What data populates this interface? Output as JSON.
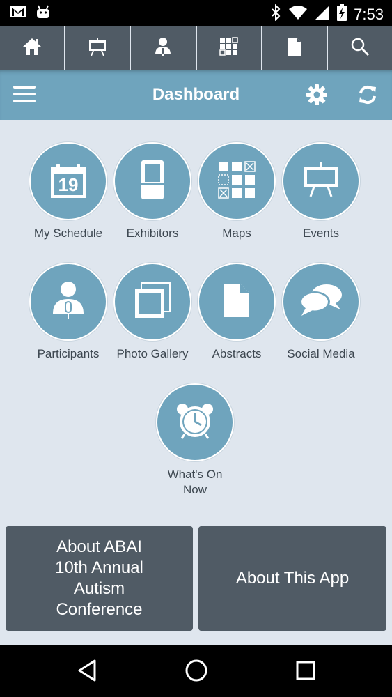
{
  "status_bar": {
    "time": "7:53",
    "left_icons": [
      "gmail-icon",
      "android-icon"
    ],
    "right_icons": [
      "bluetooth-icon",
      "wifi-icon",
      "signal-icon",
      "battery-charging-icon"
    ]
  },
  "toolbar": {
    "items": [
      "home-icon",
      "presentation-board-icon",
      "speaker-icon",
      "grid-map-icon",
      "document-icon",
      "search-icon"
    ]
  },
  "header": {
    "title": "Dashboard",
    "icons": [
      "menu-icon",
      "gear-icon",
      "refresh-icon"
    ]
  },
  "tiles": [
    {
      "label": "My Schedule",
      "icon": "calendar-icon",
      "calendar_day": "19"
    },
    {
      "label": "Exhibitors",
      "icon": "booth-icon"
    },
    {
      "label": "Maps",
      "icon": "grid-map-icon"
    },
    {
      "label": "Events",
      "icon": "presentation-board-icon"
    },
    {
      "label": "Participants",
      "icon": "speaker-icon"
    },
    {
      "label": "Photo Gallery",
      "icon": "photo-stack-icon"
    },
    {
      "label": "Abstracts",
      "icon": "document-icon"
    },
    {
      "label": "Social Media",
      "icon": "chat-bubbles-icon"
    },
    {
      "label_line1": "What's On",
      "label_line2": "Now",
      "icon": "alarm-clock-icon"
    }
  ],
  "buttons": {
    "about_conference": [
      "About ABAI",
      "10th Annual",
      "Autism",
      "Conference"
    ],
    "about_app": "About This App"
  },
  "nav_bar": {
    "icons": [
      "back-icon",
      "home-circle-icon",
      "recents-icon"
    ]
  },
  "colors": {
    "accent": "#6fa4bd",
    "dark": "#505b65",
    "background": "#dfe6ee",
    "label_text": "#3d4750"
  }
}
